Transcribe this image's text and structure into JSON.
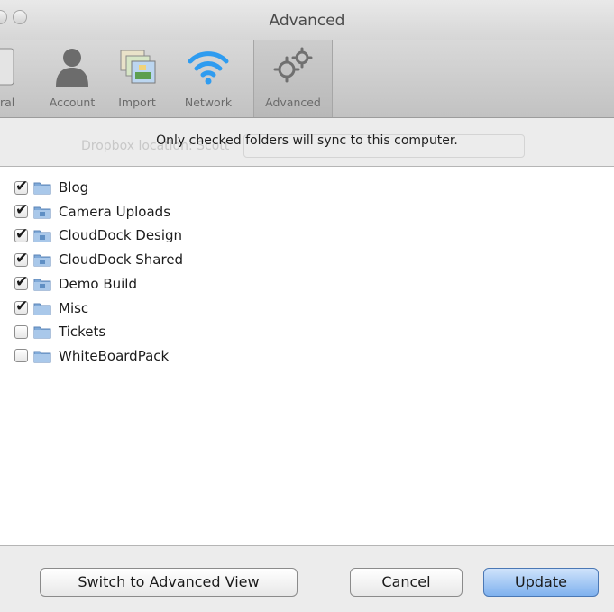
{
  "window": {
    "title": "Advanced"
  },
  "toolbar": {
    "items": [
      {
        "label": "ral",
        "icon": "general-icon",
        "selected": false
      },
      {
        "label": "Account",
        "icon": "account-icon",
        "selected": false
      },
      {
        "label": "Import",
        "icon": "import-icon",
        "selected": false
      },
      {
        "label": "Network",
        "icon": "network-icon",
        "selected": false
      },
      {
        "label": "Advanced",
        "icon": "advanced-gear-icon",
        "selected": true
      }
    ]
  },
  "header": {
    "instruction": "Only checked folders will sync to this computer.",
    "background_faded_text": "Dropbox location:   Scott"
  },
  "folders": [
    {
      "name": "Blog",
      "checked": true,
      "shared": false
    },
    {
      "name": "Camera Uploads",
      "checked": true,
      "shared": true
    },
    {
      "name": "CloudDock Design",
      "checked": true,
      "shared": true
    },
    {
      "name": "CloudDock Shared",
      "checked": true,
      "shared": true
    },
    {
      "name": "Demo Build",
      "checked": true,
      "shared": true
    },
    {
      "name": "Misc",
      "checked": true,
      "shared": false
    },
    {
      "name": "Tickets",
      "checked": false,
      "shared": false
    },
    {
      "name": "WhiteBoardPack",
      "checked": false,
      "shared": false
    }
  ],
  "buttons": {
    "switch_view": "Switch to Advanced View",
    "cancel": "Cancel",
    "update": "Update"
  },
  "colors": {
    "folder_blue": "#7fa9d8",
    "primary_button": "#7fb1ee",
    "network_icon": "#2f9cf0"
  }
}
